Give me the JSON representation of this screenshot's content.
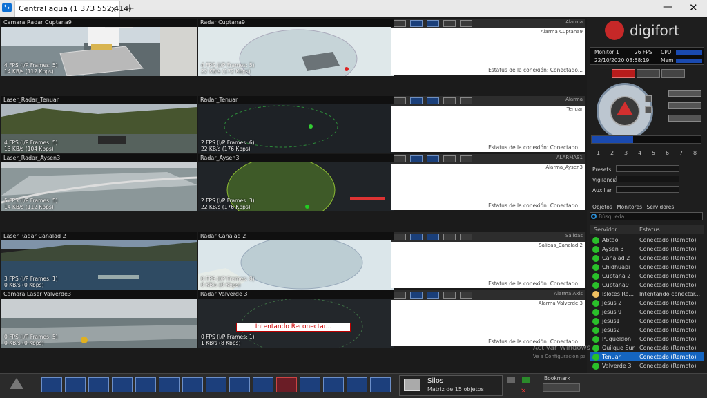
{
  "window": {
    "tab_title": "Central agua (1 373 552 414)",
    "tab_close": "x",
    "add_tab": "+",
    "minimize": "—",
    "close": "✕"
  },
  "cameras": [
    {
      "title": "Camara Radar Cuptana9",
      "stats": [
        "4 FPS (I/P Frames: 5)",
        "14 KB/s (112 Kbps)"
      ]
    },
    {
      "title": "Radar Cuptana9",
      "stats": [
        "4 FPS (I/P Frames: 5)",
        "22 KB/s (172 Kbps)"
      ]
    },
    {
      "title": "Laser_Radar_Tenuar",
      "stats": [
        "4 FPS (I/P Frames: 5)",
        "13 KB/s (104 Kbps)"
      ]
    },
    {
      "title": "Radar_Tenuar",
      "stats": [
        "2 FPS (I/P Frames: 6)",
        "22 KB/s (176 Kbps)"
      ]
    },
    {
      "title": "Laser_Radar_Aysen3",
      "stats": [
        "5 FPS (I/P Frames: 5)",
        "14 KB/s (112 Kbps)"
      ]
    },
    {
      "title": "Radar_Aysen3",
      "stats": [
        "2 FPS (I/P Frames: 3)",
        "22 KB/s (176 Kbps)"
      ]
    },
    {
      "title": "Laser Radar Canalad 2",
      "stats": [
        "3 FPS (I/P Frames: 1)",
        "0 KB/s (0 Kbps)"
      ]
    },
    {
      "title": "Radar Canalad 2",
      "stats": [
        "0 FPS (I/P Frames: 8)",
        "0 KB/s (0 Kbps)"
      ]
    },
    {
      "title": "Camara Laser Valverde3",
      "stats": [
        "0 FPS (I/P Frames: 5)",
        "0 KB/s (0 Kbps)"
      ]
    },
    {
      "title": "Radar Valverde 3",
      "stats": [
        "0 FPS (I/P Frames: 1)",
        "1 KB/s (8 Kbps)"
      ]
    }
  ],
  "reconnect_text": "Intentando Reconectar...",
  "alarm_panels": [
    {
      "corner": "Alarma",
      "sub": "Alarma Cuptana9",
      "status": "Estatus de la conexión: Conectado..."
    },
    {
      "corner": "Alarma",
      "sub": "Tenuar",
      "status": "Estatus de la conexión: Conectado..."
    },
    {
      "corner": "ALARMAS1",
      "sub": "Alarma_Aysen3",
      "status": "Estatus de la conexión: Conectado..."
    },
    {
      "corner": "Salidas",
      "sub": "Salidas_Canalad 2",
      "status": "Estatus de la conexión: Conectado..."
    },
    {
      "corner": "Alarma Axis",
      "sub": "Alarma Valverde 3",
      "status": "Estatus de la conexión: Conectado..."
    }
  ],
  "sidebar": {
    "logo": "digifort",
    "monitor": "Monitor 1",
    "fps": "26 FPS",
    "cpu_label": "CPU",
    "datetime": "22/10/2020 08:58:19",
    "mem_label": "Mem",
    "preset_numbers": [
      "1",
      "2",
      "3",
      "4",
      "5",
      "6",
      "7",
      "8"
    ],
    "presets_label": "Presets",
    "vigilance_label": "Vigilancia",
    "aux_label": "Auxiliar",
    "tabs": [
      "Objetos",
      "Monitores",
      "Servidores"
    ],
    "search_placeholder": "Búsqueda",
    "columns": [
      "Servidor",
      "Estatus"
    ],
    "servers": [
      {
        "name": "Abtao",
        "status": "Conectado (Remoto)",
        "color": "#2ac02a"
      },
      {
        "name": "Aysen 3",
        "status": "Conectado (Remoto)",
        "color": "#2ac02a"
      },
      {
        "name": "Canalad 2",
        "status": "Conectado (Remoto)",
        "color": "#2ac02a"
      },
      {
        "name": "Chidhuapi",
        "status": "Conectado (Remoto)",
        "color": "#2ac02a"
      },
      {
        "name": "Cuptana 2",
        "status": "Conectado (Remoto)",
        "color": "#2ac02a"
      },
      {
        "name": "Cuptana9",
        "status": "Conectado (Remoto)",
        "color": "#2ac02a"
      },
      {
        "name": "Islotes Ro...",
        "status": "Intentando conectar...",
        "color": "#f0c060"
      },
      {
        "name": "Jesus 2",
        "status": "Conectado (Remoto)",
        "color": "#2ac02a"
      },
      {
        "name": "jesus 9",
        "status": "Conectado (Remoto)",
        "color": "#2ac02a"
      },
      {
        "name": "jesus1",
        "status": "Conectado (Remoto)",
        "color": "#2ac02a"
      },
      {
        "name": "jesus2",
        "status": "Conectado (Remoto)",
        "color": "#2ac02a"
      },
      {
        "name": "Puqueldon",
        "status": "Conectado (Remoto)",
        "color": "#2ac02a"
      },
      {
        "name": "Quilque Sur",
        "status": "Conectado (Remoto)",
        "color": "#2ac02a"
      },
      {
        "name": "Tenuar",
        "status": "Conectado (Remoto)",
        "color": "#2ac02a"
      },
      {
        "name": "Valverde 3",
        "status": "Conectado (Remoto)",
        "color": "#2ac02a"
      }
    ]
  },
  "bottom": {
    "view_title": "Silos",
    "view_subtitle": "Matriz de 15 objetos",
    "bookmark": "Bookmark"
  },
  "watermark": {
    "line1": "Activar Windows",
    "line2": "Ve a Configuración para activar Windows."
  }
}
